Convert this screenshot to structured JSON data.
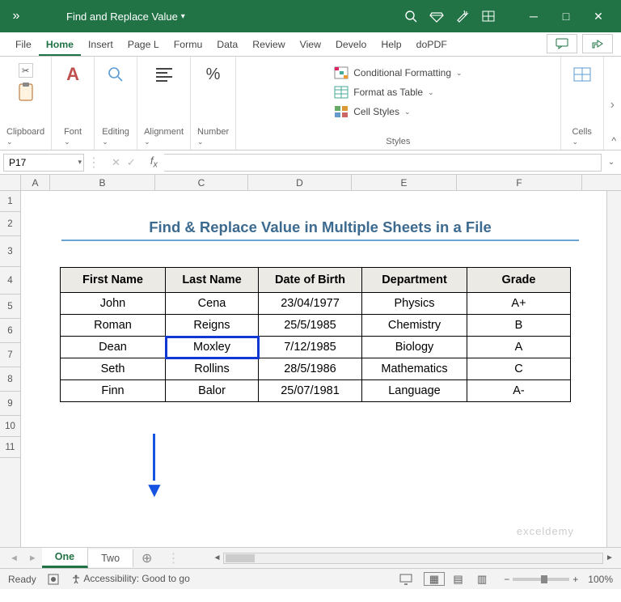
{
  "titlebar": {
    "title": "Find and Replace Value"
  },
  "menu": {
    "file": "File",
    "home": "Home",
    "insert": "Insert",
    "page": "Page L",
    "formulas": "Formu",
    "data": "Data",
    "review": "Review",
    "view": "View",
    "developer": "Develo",
    "help": "Help",
    "dopdf": "doPDF"
  },
  "ribbon": {
    "clipboard": "Clipboard",
    "font": "Font",
    "editing": "Editing",
    "alignment": "Alignment",
    "number": "Number",
    "styles": "Styles",
    "cells": "Cells",
    "cond_format": "Conditional Formatting",
    "format_table": "Format as Table",
    "cell_styles": "Cell Styles"
  },
  "namebox": "P17",
  "columns": [
    "A",
    "B",
    "C",
    "D",
    "E",
    "F"
  ],
  "rows": [
    "1",
    "2",
    "3",
    "4",
    "5",
    "6",
    "7",
    "8",
    "9",
    "10",
    "11"
  ],
  "sheet_title": "Find & Replace Value in Multiple Sheets in a File",
  "headers": {
    "c1": "First Name",
    "c2": "Last Name",
    "c3": "Date of Birth",
    "c4": "Department",
    "c5": "Grade"
  },
  "table": [
    {
      "fn": "John",
      "ln": "Cena",
      "dob": "23/04/1977",
      "dep": "Physics",
      "gr": "A+"
    },
    {
      "fn": "Roman",
      "ln": "Reigns",
      "dob": "25/5/1985",
      "dep": "Chemistry",
      "gr": "B"
    },
    {
      "fn": "Dean",
      "ln": "Moxley",
      "dob": "7/12/1985",
      "dep": "Biology",
      "gr": "A"
    },
    {
      "fn": "Seth",
      "ln": "Rollins",
      "dob": "28/5/1986",
      "dep": "Mathematics",
      "gr": "C"
    },
    {
      "fn": "Finn",
      "ln": "Balor",
      "dob": "25/07/1981",
      "dep": "Language",
      "gr": "A-"
    }
  ],
  "tabs": {
    "one": "One",
    "two": "Two"
  },
  "status": {
    "ready": "Ready",
    "accessibility": "Accessibility: Good to go",
    "zoom": "100%"
  },
  "watermark": "exceldemy"
}
